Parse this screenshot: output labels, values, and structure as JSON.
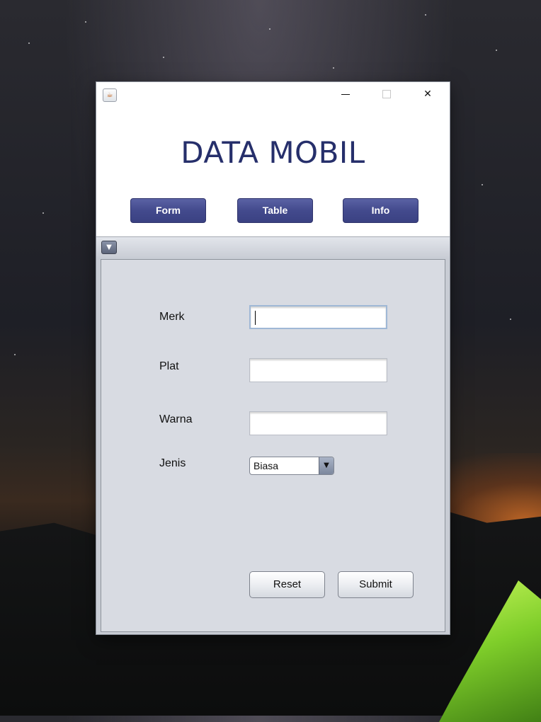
{
  "window": {
    "icon": "java-coffee-icon",
    "controls": {
      "minimize": "minimize-icon",
      "maximize": "maximize-icon",
      "close": "close-icon"
    },
    "close_glyph": "✕"
  },
  "header": {
    "title": "DATA MOBIL",
    "nav": [
      {
        "label": "Form"
      },
      {
        "label": "Table"
      },
      {
        "label": "Info"
      }
    ]
  },
  "panel": {
    "collapse_glyph": "▼"
  },
  "form": {
    "merk": {
      "label": "Merk",
      "value": ""
    },
    "plat": {
      "label": "Plat",
      "value": ""
    },
    "warna": {
      "label": "Warna",
      "value": ""
    },
    "jenis": {
      "label": "Jenis",
      "selected": "Biasa",
      "arrow_glyph": "▼"
    },
    "reset_label": "Reset",
    "submit_label": "Submit"
  },
  "colors": {
    "title": "#262f6b",
    "nav_button": "#434a8d",
    "panel_bg": "#d8dbe2"
  }
}
